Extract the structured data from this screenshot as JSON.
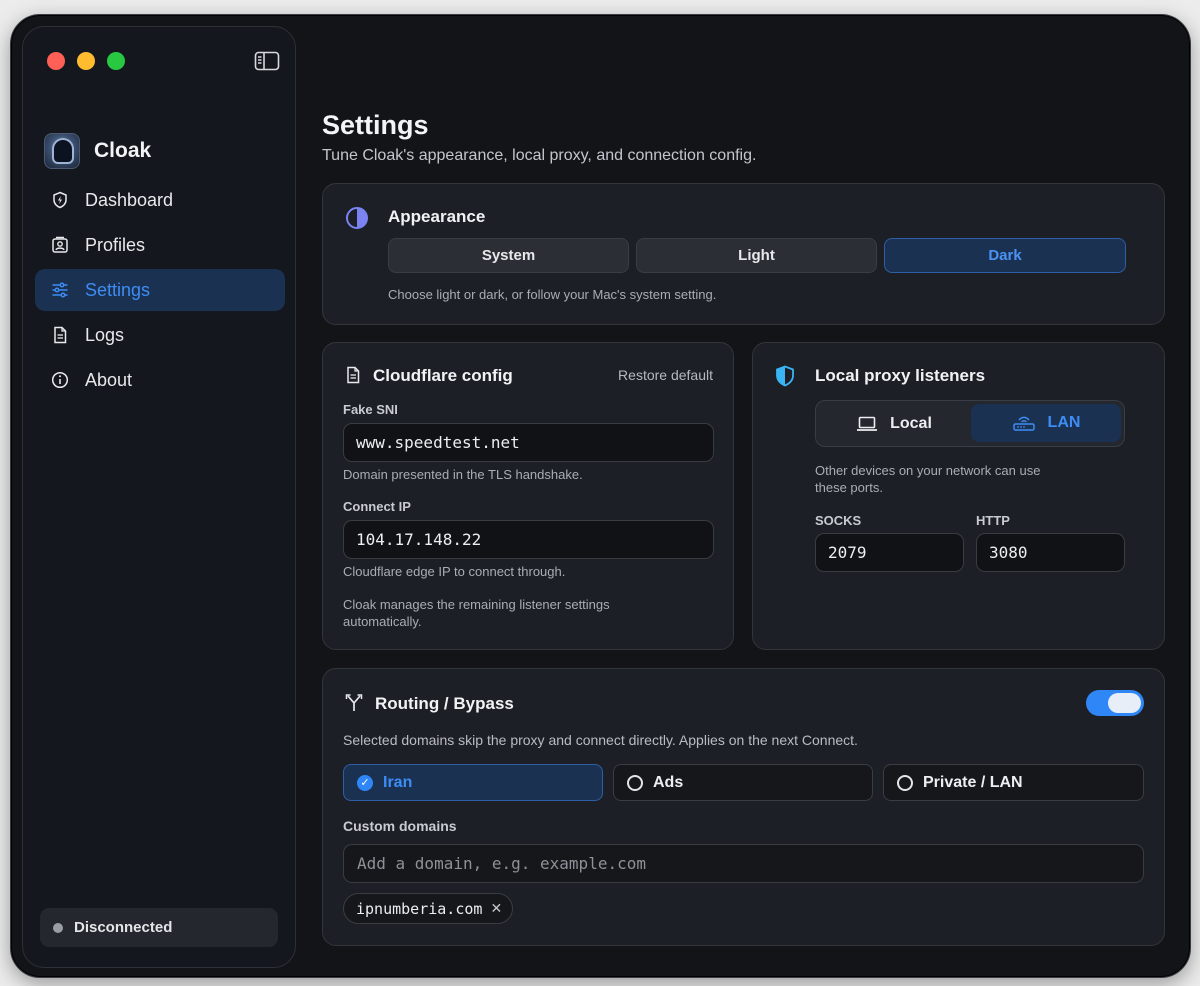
{
  "app": {
    "name": "Cloak"
  },
  "nav": [
    {
      "label": "Dashboard",
      "icon": "shield-bolt-icon"
    },
    {
      "label": "Profiles",
      "icon": "person-card-icon"
    },
    {
      "label": "Settings",
      "icon": "sliders-icon",
      "active": true
    },
    {
      "label": "Logs",
      "icon": "document-icon"
    },
    {
      "label": "About",
      "icon": "info-icon"
    }
  ],
  "status": {
    "label": "Disconnected",
    "color": "#9a9da3"
  },
  "page": {
    "title": "Settings",
    "subtitle": "Tune Cloak's appearance, local proxy, and connection config."
  },
  "appearance": {
    "title": "Appearance",
    "options": [
      "System",
      "Light",
      "Dark"
    ],
    "selected": "Dark",
    "hint": "Choose light or dark, or follow your Mac's system setting."
  },
  "cloudflare": {
    "title": "Cloudflare config",
    "restore_label": "Restore default",
    "sni_label": "Fake SNI",
    "sni_value": "www.speedtest.net",
    "sni_hint": "Domain presented in the TLS handshake.",
    "ip_label": "Connect IP",
    "ip_value": "104.17.148.22",
    "ip_hint": "Cloudflare edge IP to connect through.",
    "footer": "Cloak manages the remaining listener settings automatically."
  },
  "proxy": {
    "title": "Local proxy listeners",
    "modes": [
      "Local",
      "LAN"
    ],
    "selected": "LAN",
    "hint": "Other devices on your network can use these ports.",
    "socks_label": "SOCKS",
    "socks_value": "2079",
    "http_label": "HTTP",
    "http_value": "3080"
  },
  "routing": {
    "title": "Routing / Bypass",
    "enabled": true,
    "description": "Selected domains skip the proxy and connect directly. Applies on the next Connect.",
    "options": [
      {
        "label": "Iran",
        "checked": true
      },
      {
        "label": "Ads",
        "checked": false
      },
      {
        "label": "Private / LAN",
        "checked": false
      }
    ],
    "custom_label": "Custom domains",
    "custom_placeholder": "Add a domain, e.g. example.com",
    "domains": [
      "ipnumberia.com"
    ]
  },
  "colors": {
    "accent": "#2f86f7",
    "background": "#121418",
    "card": "#1c1f25"
  }
}
